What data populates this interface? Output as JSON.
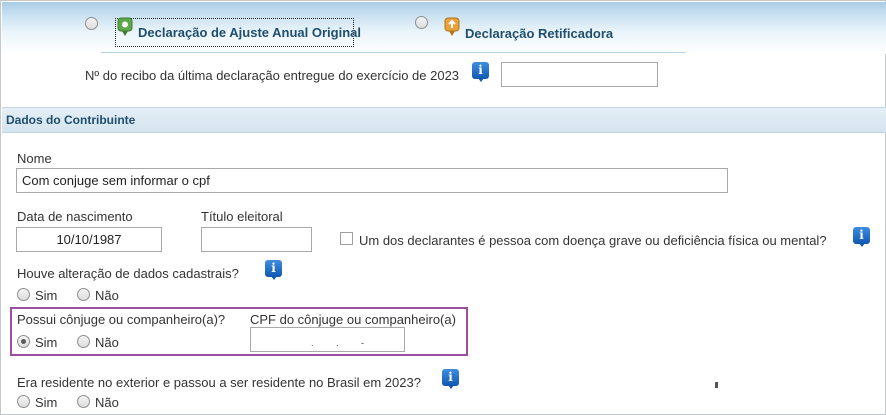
{
  "declaration": {
    "original_label": "Declaração de Ajuste Anual Original",
    "retificadora_label": "Declaração Retificadora"
  },
  "receipt": {
    "label": "Nº do recibo da última declaração entregue do exercício de 2023",
    "value": ""
  },
  "section": {
    "title": "Dados do Contribuinte"
  },
  "contribuinte": {
    "nome_label": "Nome",
    "nome_value": "Com conjuge sem informar o cpf",
    "nascimento_label": "Data de nascimento",
    "nascimento_value": "10/10/1987",
    "titulo_label": "Título eleitoral",
    "titulo_value": "",
    "doenca_label": "Um dos declarantes é pessoa com doença grave ou deficiência física ou mental?",
    "alteracao_label": "Houve alteração de dados cadastrais?",
    "conjuge_label": "Possui cônjuge ou companheiro(a)?",
    "cpf_conjuge_label": "CPF do cônjuge ou companheiro(a)",
    "cpf_conjuge_value": "",
    "residente_label": "Era residente no exterior e passou a ser residente no Brasil em 2023?"
  },
  "options": {
    "sim": "Sim",
    "nao": "Não"
  },
  "info_glyph": "i",
  "colors": {
    "accent_text": "#1f4e6e",
    "highlight_border": "#9a4fa0",
    "info_icon": "#1a66c2"
  }
}
